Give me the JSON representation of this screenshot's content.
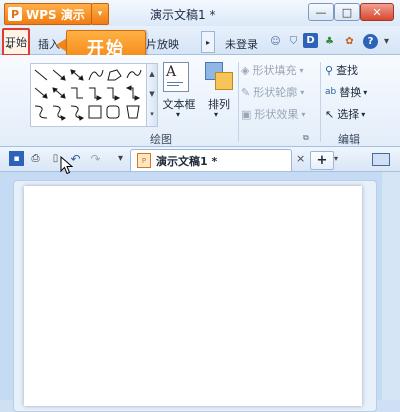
{
  "titlebar": {
    "app_button": "WPS 演示",
    "app_logo": "P",
    "app_dropdown": "▾",
    "doc_title": "演示文稿1 *",
    "min": "—",
    "max": "□",
    "close": "✕"
  },
  "tabs": {
    "home": "开始",
    "insert": "插入",
    "slideshow": "片放映",
    "login": "未登录"
  },
  "callout": {
    "text": "开始"
  },
  "ribbon": {
    "textbox": "文本框",
    "arrange": "排列",
    "shape_fill": "形状填充",
    "shape_outline": "形状轮廓",
    "shape_effect": "形状效果",
    "find": "查找",
    "replace": "替换",
    "select": "选择",
    "group_drawing": "绘图",
    "group_edit": "编辑"
  },
  "docbar": {
    "doc_tab": "演示文稿1 *",
    "doc_close": "×",
    "new_tab": "+"
  },
  "colors": {
    "accent_orange": "#f07c12",
    "highlight_red": "#e13a32",
    "ribbon_blue": "#d5e4f6"
  }
}
